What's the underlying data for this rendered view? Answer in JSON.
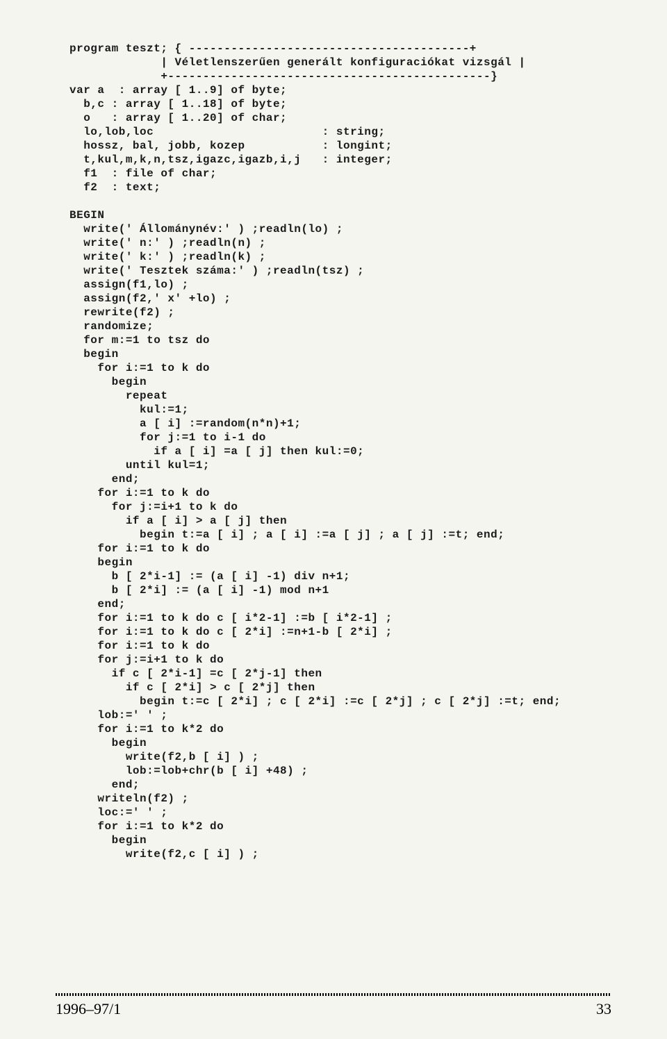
{
  "code": "program teszt; { ----------------------------------------+\n             | Véletlenszerűen generált konfiguraciókat vizsgál |\n             +----------------------------------------------}\nvar a  : array [ 1..9] of byte;\n  b,c : array [ 1..18] of byte;\n  o   : array [ 1..20] of char;\n  lo,lob,loc                        : string;\n  hossz, bal, jobb, kozep           : longint;\n  t,kul,m,k,n,tsz,igazc,igazb,i,j   : integer;\n  f1  : file of char;\n  f2  : text;\n\nBEGIN\n  write(' Állománynév:' ) ;readln(lo) ;\n  write(' n:' ) ;readln(n) ;\n  write(' k:' ) ;readln(k) ;\n  write(' Tesztek száma:' ) ;readln(tsz) ;\n  assign(f1,lo) ;\n  assign(f2,' x' +lo) ;\n  rewrite(f2) ;\n  randomize;\n  for m:=1 to tsz do\n  begin\n    for i:=1 to k do\n      begin\n        repeat\n          kul:=1;\n          a [ i] :=random(n*n)+1;\n          for j:=1 to i-1 do\n            if a [ i] =a [ j] then kul:=0;\n        until kul=1;\n      end;\n    for i:=1 to k do\n      for j:=i+1 to k do\n        if a [ i] > a [ j] then\n          begin t:=a [ i] ; a [ i] :=a [ j] ; a [ j] :=t; end;\n    for i:=1 to k do\n    begin\n      b [ 2*i-1] := (a [ i] -1) div n+1;\n      b [ 2*i] := (a [ i] -1) mod n+1\n    end;\n    for i:=1 to k do c [ i*2-1] :=b [ i*2-1] ;\n    for i:=1 to k do c [ 2*i] :=n+1-b [ 2*i] ;\n    for i:=1 to k do\n    for j:=i+1 to k do\n      if c [ 2*i-1] =c [ 2*j-1] then\n        if c [ 2*i] > c [ 2*j] then\n          begin t:=c [ 2*i] ; c [ 2*i] :=c [ 2*j] ; c [ 2*j] :=t; end;\n    lob:=' ' ;\n    for i:=1 to k*2 do\n      begin\n        write(f2,b [ i] ) ;\n        lob:=lob+chr(b [ i] +48) ;\n      end;\n    writeln(f2) ;\n    loc:=' ' ;\n    for i:=1 to k*2 do\n      begin\n        write(f2,c [ i] ) ;",
  "footer": {
    "issue": "1996–97/1",
    "page": "33"
  }
}
